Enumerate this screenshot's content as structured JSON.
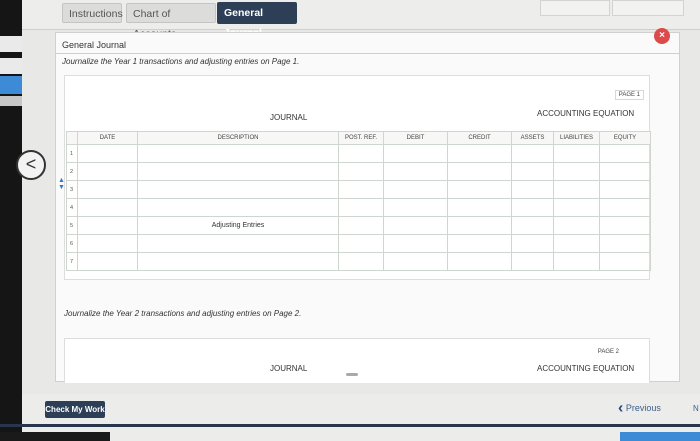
{
  "tabs": [
    {
      "label": "Instructions"
    },
    {
      "label": "Chart of Accounts"
    },
    {
      "label": "General Journal"
    }
  ],
  "panel": {
    "title": "General Journal",
    "instruction_year1": "Journalize the Year 1 transactions and adjusting entries on Page 1.",
    "instruction_year2": "Journalize the Year 2 transactions and adjusting entries on Page 2."
  },
  "page1": {
    "page_label": "PAGE 1",
    "journal_header": "JOURNAL",
    "equation_header": "ACCOUNTING EQUATION",
    "columns": [
      "DATE",
      "DESCRIPTION",
      "POST. REF.",
      "DEBIT",
      "CREDIT",
      "ASSETS",
      "LIABILITIES",
      "EQUITY"
    ],
    "rows": [
      {
        "num": "1",
        "description": ""
      },
      {
        "num": "2",
        "description": ""
      },
      {
        "num": "3",
        "description": ""
      },
      {
        "num": "4",
        "description": ""
      },
      {
        "num": "5",
        "description": "Adjusting Entries"
      },
      {
        "num": "6",
        "description": ""
      },
      {
        "num": "7",
        "description": ""
      }
    ]
  },
  "page2": {
    "page_label": "PAGE 2",
    "journal_header": "JOURNAL",
    "equation_header": "ACCOUNTING EQUATION"
  },
  "footer": {
    "check_label": "Check My Work",
    "previous_label": "Previous",
    "next_label": "N"
  },
  "icons": {
    "back": "chevron-left-icon",
    "close": "close-icon",
    "row_reorder": "reorder-arrows-icon"
  },
  "colors": {
    "accent": "#2c3f57",
    "close": "#dc4a4a",
    "link": "#3b5f8c"
  }
}
